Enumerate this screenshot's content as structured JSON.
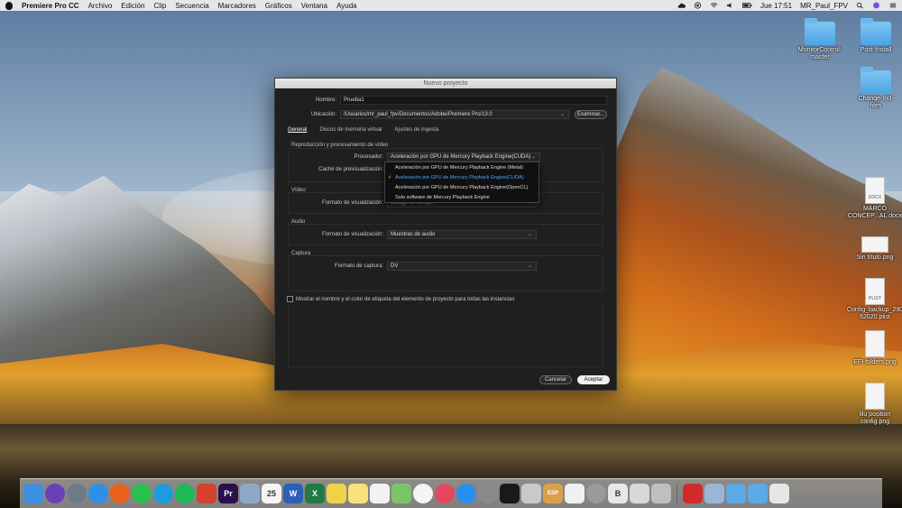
{
  "menubar": {
    "app_name": "Premiere Pro CC",
    "menus": [
      "Archivo",
      "Edición",
      "Clip",
      "Secuencia",
      "Marcadores",
      "Gráficos",
      "Ventana",
      "Ayuda"
    ],
    "clock": "Jue 17:51",
    "user": "MR_Paul_FPV",
    "status_icons": [
      "cloud-icon",
      "record-icon",
      "wifi-icon",
      "volume-icon",
      "battery-icon",
      "search-icon",
      "siri-icon",
      "notifications-icon"
    ]
  },
  "desktop_icons": [
    {
      "label": "MonitorControl-\nmaster",
      "kind": "folder"
    },
    {
      "label": "Post-Install",
      "kind": "folder"
    },
    {
      "label": "Change-Ind-\nfiles",
      "kind": "folder"
    },
    {
      "label": "MARCO\nCONCEP...AL.docx",
      "kind": "doc",
      "tag": "DOCX"
    },
    {
      "label": "Sin título.png",
      "kind": "image"
    },
    {
      "label": "Config_backup_290\n62020.plist",
      "kind": "doc",
      "tag": "PLIST"
    },
    {
      "label": "EFI folders.png",
      "kind": "image"
    },
    {
      "label": "lilu position\nconfig.png",
      "kind": "image"
    }
  ],
  "dialog": {
    "title": "Nuevo proyecto",
    "name_label": "Nombre:",
    "name_value": "Prueba1",
    "location_label": "Ubicación:",
    "location_value": "/Usuarios/mr_paul_fpv/Documentos/Adobe/Premiere Pro/13.0",
    "browse_button": "Examinar...",
    "tabs": [
      "General",
      "Discos de memoria virtual",
      "Ajustes de ingesta"
    ],
    "playback_section": "Reproducción y procesamiento de vídeo",
    "renderer_label": "Procesador:",
    "renderer_value": "Aceleración por GPU de Mercury Playback Engine(CUDA)",
    "preview_cache_label": "Caché de previsualización:",
    "renderer_options": [
      "Aceleración por GPU de Mercury Playback Engine (Metal)",
      "Aceleración por GPU de Mercury Playback Engine(CUDA)",
      "Aceleración por GPU de Mercury Playback Engine(OpenCL)",
      "Solo software de Mercury Playback Engine"
    ],
    "renderer_selected_index": 1,
    "video_section": "Vídeo",
    "video_display_label": "Formato de visualización:",
    "video_display_value": "Código de tiempo",
    "audio_section": "Audio",
    "audio_display_label": "Formato de visualización:",
    "audio_display_value": "Muestras de audio",
    "capture_section": "Captura",
    "capture_format_label": "Formato de captura:",
    "capture_format_value": "DV",
    "checkbox_label": "Mostrar el nombre y el color de etiqueta del elemento de proyecto para todas las instancias",
    "checkbox_checked": false,
    "cancel_button": "Cancelar",
    "ok_button": "Aceptar"
  },
  "dock": {
    "apps": [
      {
        "name": "finder-icon",
        "color": "#3d8fe0"
      },
      {
        "name": "siri-icon",
        "color": "#6b3fb8"
      },
      {
        "name": "launchpad-icon",
        "color": "#6b7b8c"
      },
      {
        "name": "safari-icon",
        "color": "#2d8fe6"
      },
      {
        "name": "firefox-icon",
        "color": "#e8621c"
      },
      {
        "name": "whatsapp-icon",
        "color": "#2bbf4f"
      },
      {
        "name": "skype-icon",
        "color": "#1b9ce0"
      },
      {
        "name": "spotify-icon",
        "color": "#1db954"
      },
      {
        "name": "anydesk-icon",
        "color": "#d4412d"
      },
      {
        "name": "premiere-icon",
        "color": "#2a0f4a",
        "text": "Pr"
      },
      {
        "name": "preview-icon",
        "color": "#8fa8c8"
      },
      {
        "name": "calendar-icon",
        "color": "#f5f5f5",
        "text": "25"
      },
      {
        "name": "word-icon",
        "color": "#2b5fb8",
        "text": "W"
      },
      {
        "name": "excel-icon",
        "color": "#1f7a44",
        "text": "X"
      },
      {
        "name": "stickies-icon",
        "color": "#f0d24a"
      },
      {
        "name": "notes-icon",
        "color": "#f7e27a"
      },
      {
        "name": "reminders-icon",
        "color": "#f2f2f2"
      },
      {
        "name": "maps-icon",
        "color": "#7cc46a"
      },
      {
        "name": "photos-icon",
        "color": "#f4f4f4"
      },
      {
        "name": "music-icon",
        "color": "#e8465c"
      },
      {
        "name": "appstore-icon",
        "color": "#2a8ef0"
      },
      {
        "name": "system-preferences-icon",
        "color": "#8a8a8a"
      },
      {
        "name": "terminal-icon",
        "color": "#1a1a1a"
      },
      {
        "name": "tools-icon",
        "color": "#c9c9c9"
      },
      {
        "name": "esp-icon",
        "color": "#d9a24a",
        "text": "ESP"
      },
      {
        "name": "textedit-icon",
        "color": "#f0f0f0"
      },
      {
        "name": "disk-utility-icon",
        "color": "#9a9a9a"
      },
      {
        "name": "bbedit-icon",
        "color": "#e8e8e8",
        "text": "B"
      },
      {
        "name": "script-editor-icon",
        "color": "#d8d8d8"
      },
      {
        "name": "screenshot-icon",
        "color": "#bfbfbf"
      }
    ],
    "extras": [
      {
        "name": "adobe-cc-icon",
        "color": "#d12a2a"
      },
      {
        "name": "preview-stack-icon",
        "color": "#9ab6d6"
      },
      {
        "name": "applications-folder-icon",
        "color": "#5aaae6"
      },
      {
        "name": "downloads-folder-icon",
        "color": "#5aaae6"
      },
      {
        "name": "trash-icon",
        "color": "#e6e6e6"
      }
    ]
  }
}
